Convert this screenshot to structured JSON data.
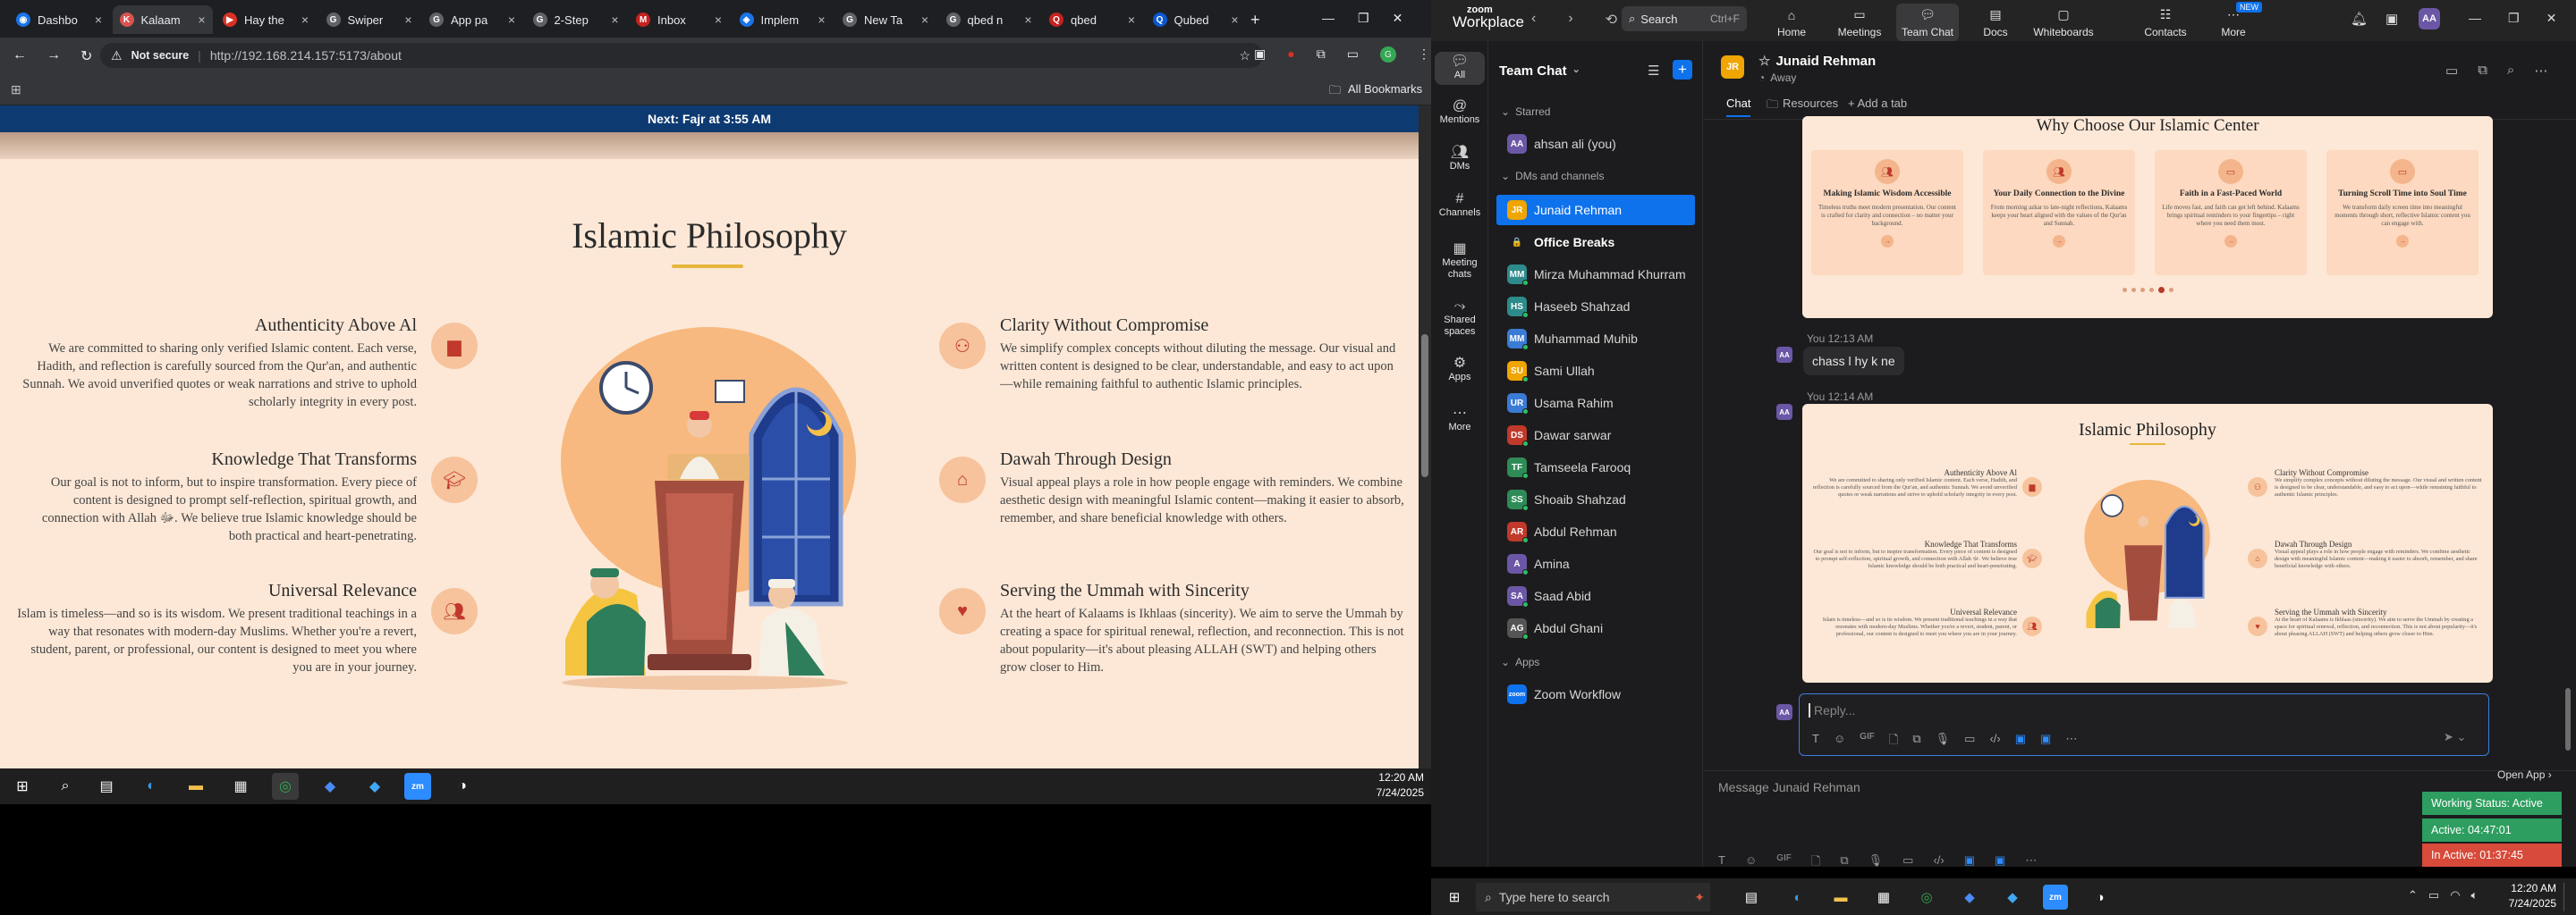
{
  "browser": {
    "tabs": [
      {
        "label": "Dashbo",
        "color": "#1a73e8",
        "glyph": "◉"
      },
      {
        "label": "Kalaam",
        "color": "#d9534f",
        "glyph": "K",
        "active": true
      },
      {
        "label": "Hay the",
        "color": "#d93025",
        "glyph": "▶"
      },
      {
        "label": "Swiper",
        "color": "#5f6368",
        "glyph": "G"
      },
      {
        "label": "App pa",
        "color": "#5f6368",
        "glyph": "G"
      },
      {
        "label": "2-Step",
        "color": "#5f6368",
        "glyph": "G"
      },
      {
        "label": "Inbox",
        "color": "#c5221f",
        "glyph": "M"
      },
      {
        "label": "Implem",
        "color": "#1a73e8",
        "glyph": "◈"
      },
      {
        "label": "New Ta",
        "color": "#5f6368",
        "glyph": "G"
      },
      {
        "label": "qbed n",
        "color": "#5f6368",
        "glyph": "G"
      },
      {
        "label": "qbed",
        "color": "#c5221f",
        "glyph": "Q"
      },
      {
        "label": "Qubed",
        "color": "#0b57d0",
        "glyph": "Q"
      }
    ],
    "new_tab_glyph": "+",
    "not_secure": "Not secure",
    "url": "http://192.168.214.157:5173/about",
    "all_bookmarks": "All Bookmarks",
    "accent": "#0e3a72"
  },
  "page": {
    "prayer_bar": "Next: Fajr at 3:55 AM",
    "title": "Islamic Philosophy",
    "features_left": [
      {
        "title": "Authenticity Above Al",
        "text": "We are committed to sharing only verified Islamic content. Each verse, Hadith, and reflection is carefully sourced from the Qur'an, and authentic Sunnah. We avoid unverified quotes or weak narrations and strive to uphold scholarly integrity in every post.",
        "icon": "book-icon"
      },
      {
        "title": "Knowledge That Transforms",
        "text": "Our goal is not to inform, but to inspire transformation. Every piece of content is designed to prompt self-reflection, spiritual growth, and connection with Allah ﷻ. We believe true Islamic knowledge should be both practical and heart-penetrating.",
        "icon": "graduation-cap-icon"
      },
      {
        "title": "Universal Relevance",
        "text": "Islam is timeless—and so is its wisdom. We present traditional teachings in a way that resonates with modern-day Muslims. Whether you're a revert, student, parent, or professional, our content is designed to meet you where you are in your journey.",
        "icon": "users-icon"
      }
    ],
    "features_right": [
      {
        "title": "Clarity Without Compromise",
        "text": "We simplify complex concepts without diluting the message. Our visual and written content is designed to be clear, understandable, and easy to act upon—while remaining faithful to authentic Islamic principles.",
        "icon": "teacher-icon"
      },
      {
        "title": "Dawah Through Design",
        "text": "Visual appeal plays a role in how people engage with reminders. We combine aesthetic design with meaningful Islamic content—making it easier to absorb, remember, and share beneficial knowledge with others.",
        "icon": "mosque-icon"
      },
      {
        "title": "Serving the Ummah with Sincerity",
        "text": "At the heart of Kalaams is Ikhlaas (sincerity). We aim to serve the Ummah by creating a space for spiritual renewal, reflection, and reconnection. This is not about popularity—it's about pleasing ALLAH (SWT) and helping others grow closer to Him.",
        "icon": "heart-icon"
      }
    ]
  },
  "taskbar_left": {
    "time": "12:20 AM",
    "date": "7/24/2025"
  },
  "zoom": {
    "brand_top": "zoom",
    "brand": "Workplace",
    "search": "Search",
    "search_shortcut": "Ctrl+F",
    "nav": [
      {
        "label": "Home",
        "icon": "home-icon"
      },
      {
        "label": "Meetings",
        "icon": "video-icon"
      },
      {
        "label": "Team Chat",
        "icon": "chat-icon",
        "active": true
      },
      {
        "label": "Docs",
        "icon": "docs-icon"
      },
      {
        "label": "Whiteboards",
        "icon": "whiteboard-icon"
      },
      {
        "label": "Contacts",
        "icon": "contacts-icon"
      },
      {
        "label": "More",
        "icon": "more-icon",
        "badge": "NEW"
      }
    ],
    "avatar_initials": "AA",
    "rail": [
      {
        "label": "All",
        "icon": "chat-bubble-icon"
      },
      {
        "label": "Mentions",
        "icon": "at-icon"
      },
      {
        "label": "DMs",
        "icon": "dm-icon"
      },
      {
        "label": "Channels",
        "icon": "hash-icon"
      },
      {
        "label": "Meeting chats",
        "icon": "calendar-icon"
      },
      {
        "label": "Shared spaces",
        "icon": "shared-icon"
      },
      {
        "label": "Apps",
        "icon": "apps-icon"
      },
      {
        "label": "More",
        "icon": "ellipsis-icon"
      }
    ],
    "list_title": "Team Chat",
    "sections": {
      "starred": "Starred",
      "dms": "DMs and channels",
      "apps": "Apps"
    },
    "starred": [
      {
        "name": "ahsan ali (you)",
        "initials": "AA",
        "color": "#6b57a6"
      }
    ],
    "contacts": [
      {
        "name": "Junaid Rehman",
        "initials": "JR",
        "color": "#f0a500",
        "selected": true
      },
      {
        "name": "Office Breaks",
        "initials": "🔒",
        "color": "transparent",
        "bold": true
      },
      {
        "name": "Mirza Muhammad Khurram",
        "initials": "MM",
        "color": "#2e8b8b"
      },
      {
        "name": "Haseeb Shahzad",
        "initials": "HS",
        "color": "#2e8b8b"
      },
      {
        "name": "Muhammad Muhib",
        "initials": "MM",
        "color": "#3a7bd5"
      },
      {
        "name": "Sami Ullah",
        "initials": "SU",
        "color": "#f0a500"
      },
      {
        "name": "Usama Rahim",
        "initials": "UR",
        "color": "#3a7bd5"
      },
      {
        "name": "Dawar sarwar",
        "initials": "DS",
        "color": "#c0392b"
      },
      {
        "name": "Tamseela Farooq",
        "initials": "TF",
        "color": "#2e8b57"
      },
      {
        "name": "Shoaib Shahzad",
        "initials": "SS",
        "color": "#2e8b57"
      },
      {
        "name": "Abdul Rehman",
        "initials": "AR",
        "color": "#c0392b"
      },
      {
        "name": "Amina",
        "initials": "A",
        "color": "#6b57a6"
      },
      {
        "name": "Saad Abid",
        "initials": "SA",
        "color": "#6b57a6"
      },
      {
        "name": "Abdul Ghani",
        "initials": "AG",
        "color": "#555"
      }
    ],
    "app_item": "Zoom Workflow",
    "chat": {
      "name": "Junaid Rehman",
      "status": "Away",
      "tabs": [
        "Chat",
        "Resources",
        "+ Add a tab"
      ],
      "card_title": "Why Choose Our Islamic Center",
      "cards": [
        {
          "title": "Making Islamic Wisdom Accessible",
          "text": "Timeless truths meet modern presentation. Our content is crafted for clarity and connection – no matter your background."
        },
        {
          "title": "Your Daily Connection to the Divine",
          "text": "From morning azkar to late-night reflections, Kalaams keeps your heart aligned with the values of the Qur'an and Sunnah."
        },
        {
          "title": "Faith in a Fast-Paced World",
          "text": "Life moves fast, and faith can get left behind. Kalaams brings spiritual reminders to your fingertips – right where you need them most."
        },
        {
          "title": "Turning Scroll Time into Soul Time",
          "text": "We transform daily screen time into meaningful moments through short, reflective Islamic content you can engage with."
        }
      ],
      "msg1_time": "You 12:13 AM",
      "msg1_text": "chass l hy k ne",
      "msg2_time": "You 12:14 AM",
      "reply_placeholder": "Reply...",
      "message_placeholder": "Message Junaid Rehman",
      "open_app": "Open App ›"
    },
    "status_widget": {
      "working": "Working Status: Active",
      "active": "Active: 04:47:01",
      "inactive": "In Active: 01:37:45"
    }
  },
  "taskbar_right": {
    "search": "Type here to search",
    "time": "12:20 AM",
    "date": "7/24/2025"
  }
}
